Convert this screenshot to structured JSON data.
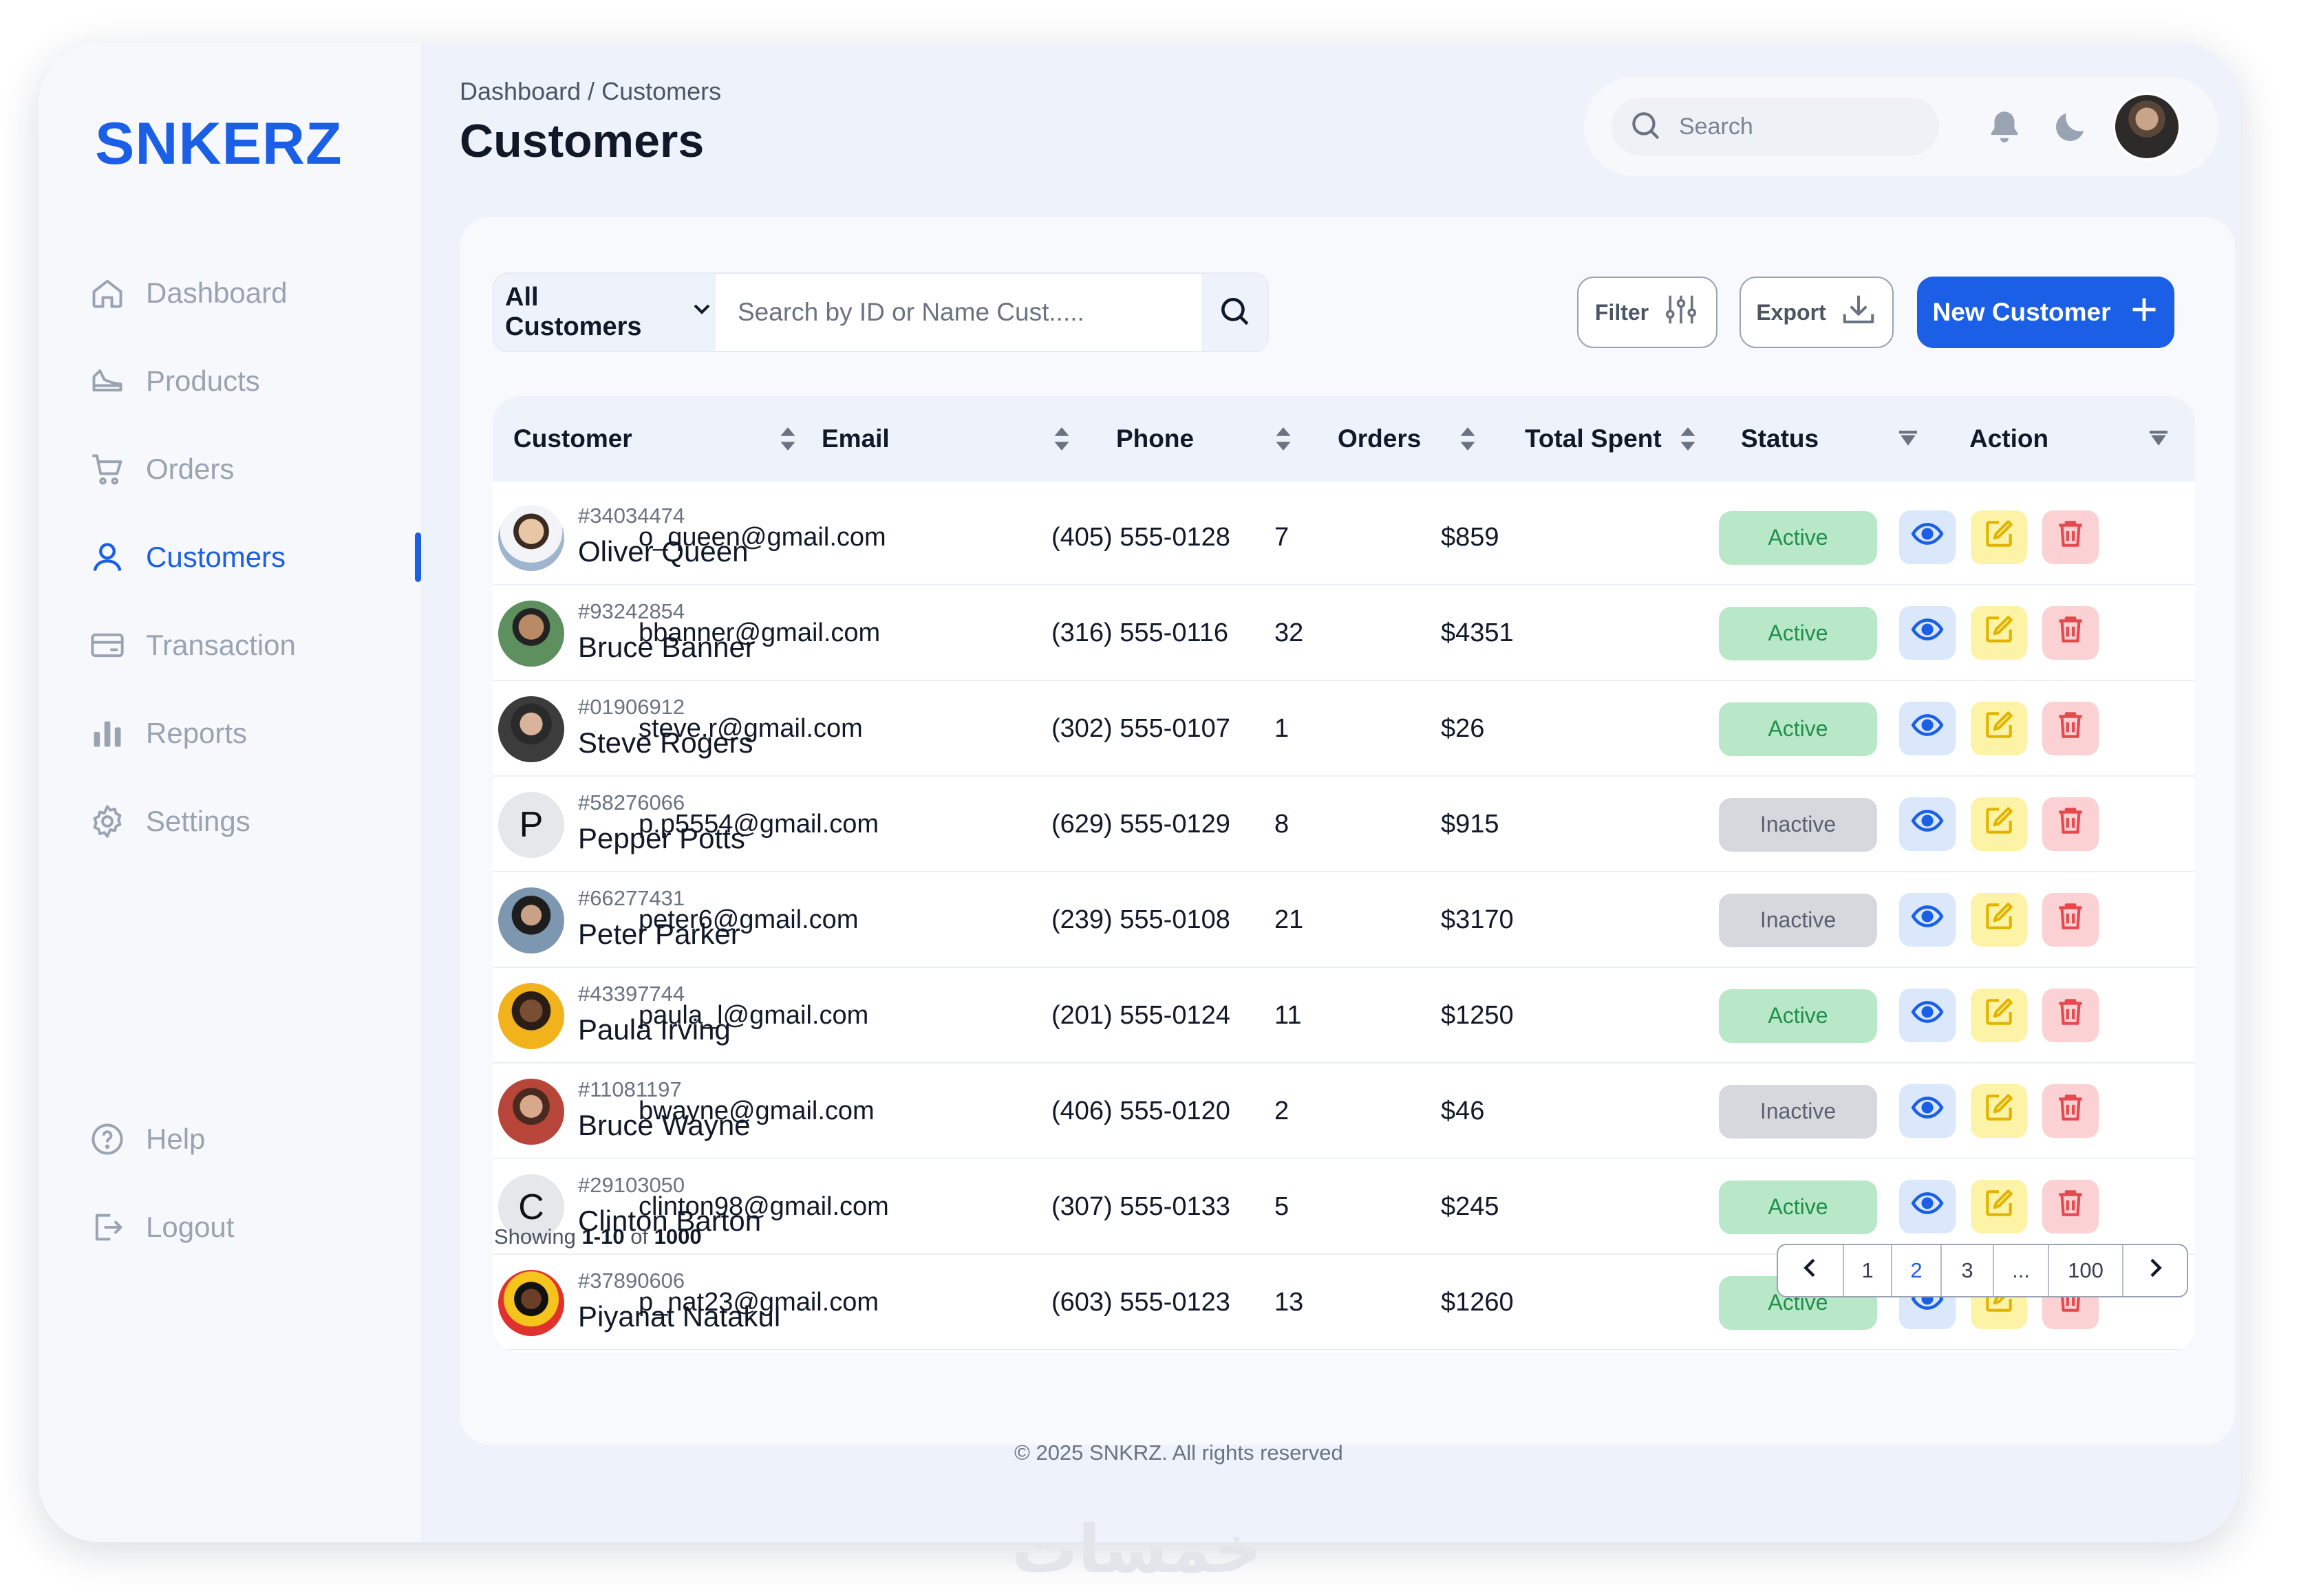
{
  "brand": "SNKERZ",
  "sidebar": {
    "items": [
      {
        "label": "Dashboard",
        "icon": "home-icon"
      },
      {
        "label": "Products",
        "icon": "sneaker-icon"
      },
      {
        "label": "Orders",
        "icon": "cart-icon"
      },
      {
        "label": "Customers",
        "icon": "user-icon",
        "active": true
      },
      {
        "label": "Transaction",
        "icon": "card-icon"
      },
      {
        "label": "Reports",
        "icon": "bar-chart-icon"
      },
      {
        "label": "Settings",
        "icon": "gear-icon"
      }
    ],
    "bottom": [
      {
        "label": "Help",
        "icon": "help-icon"
      },
      {
        "label": "Logout",
        "icon": "logout-icon"
      }
    ]
  },
  "header": {
    "breadcrumb": "Dashboard / Customers",
    "title": "Customers",
    "search_placeholder": "Search"
  },
  "toolbar": {
    "segment": "All Customers",
    "search_placeholder": "Search by ID or Name Cust.....",
    "filter_label": "Filter",
    "export_label": "Export",
    "new_label": "New Customer"
  },
  "table": {
    "columns": [
      "Customer",
      "Email",
      "Phone",
      "Orders",
      "Total Spent",
      "Status",
      "Action"
    ],
    "rows": [
      {
        "id": "#34034474",
        "name": "Oliver Queen",
        "email": "o_queen@gmail.com",
        "phone": "(405) 555-0128",
        "orders": "7",
        "spent": "$859",
        "status": "Active"
      },
      {
        "id": "#93242854",
        "name": "Bruce Banner",
        "email": "bbanner@gmail.com",
        "phone": "(316) 555-0116",
        "orders": "32",
        "spent": "$4351",
        "status": "Active"
      },
      {
        "id": "#01906912",
        "name": "Steve Rogers",
        "email": "steve.r@gmail.com",
        "phone": "(302) 555-0107",
        "orders": "1",
        "spent": "$26",
        "status": "Active"
      },
      {
        "id": "#58276066",
        "name": "Pepper Potts",
        "email": "p.p5554@gmail.com",
        "phone": "(629) 555-0129",
        "orders": "8",
        "spent": "$915",
        "status": "Inactive",
        "initial": "P"
      },
      {
        "id": "#66277431",
        "name": "Peter Parker",
        "email": "peter6@gmail.com",
        "phone": "(239) 555-0108",
        "orders": "21",
        "spent": "$3170",
        "status": "Inactive"
      },
      {
        "id": "#43397744",
        "name": "Paula Irving",
        "email": "paula_l@gmail.com",
        "phone": "(201) 555-0124",
        "orders": "11",
        "spent": "$1250",
        "status": "Active"
      },
      {
        "id": "#11081197",
        "name": "Bruce Wayne",
        "email": "bwayne@gmail.com",
        "phone": "(406) 555-0120",
        "orders": "2",
        "spent": "$46",
        "status": "Inactive"
      },
      {
        "id": "#29103050",
        "name": "Clinton Barton",
        "email": "clinton98@gmail.com",
        "phone": "(307) 555-0133",
        "orders": "5",
        "spent": "$245",
        "status": "Active",
        "initial": "C"
      },
      {
        "id": "#37890606",
        "name": "Piyanat Natakul",
        "email": "p_nat23@gmail.com",
        "phone": "(603) 555-0123",
        "orders": "13",
        "spent": "$1260",
        "status": "Active"
      }
    ]
  },
  "pagination": {
    "showing_prefix": "Showing ",
    "range": "1-10",
    "of": " of ",
    "total": "1000",
    "pages": [
      "1",
      "2",
      "3",
      "...",
      "100"
    ],
    "current": "2"
  },
  "footer": "© 2025 SNKRZ. All rights reserved",
  "watermark": "خمسات",
  "colors": {
    "accent": "#1a5fe6",
    "active_bg": "#b9e8c8",
    "inactive_bg": "#d6d8dd"
  }
}
